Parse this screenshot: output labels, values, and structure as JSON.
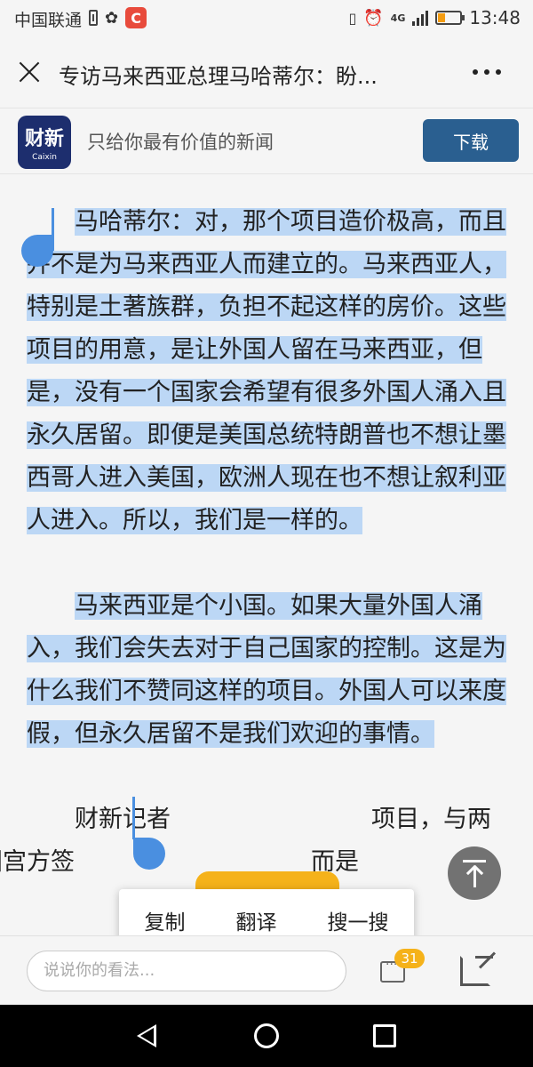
{
  "status_bar": {
    "carrier": "中国联通",
    "app_badge": "C",
    "network": "4G",
    "time": "13:48"
  },
  "title_bar": {
    "title": "专访马来西亚总理马哈蒂尔：盼..."
  },
  "app_banner": {
    "logo_main": "财新",
    "logo_sub": "Caixin",
    "slogan": "只给你最有价值的新闻",
    "download_label": "下载"
  },
  "article": {
    "paragraphs": [
      "马哈蒂尔：对，那个项目造价极高，而且并不是为马来西亚人而建立的。马来西亚人，特别是土著族群，负担不起这样的房价。这些项目的用意，是让外国人留在马来西亚，但是，没有一个国家会希望有很多外国人涌入且永久居留。即便是美国总统特朗普也不想让墨西哥人进入美国，欧洲人现在也不想让叙利亚人进入。所以，我们是一样的。",
      "马来西亚是个小国。如果大量外国人涌入，我们会失去对于自己国家的控制。这是为什么我们不赞同这样的项目。外国人可以来度假，但永久居留不是我们欢迎的事情。",
      "财新记者"
    ],
    "partial_line_right": "，与两",
    "partial_line_right_prefix": "项目",
    "bottom_left_partial": "国宫方签",
    "bottom_right_partial": "而是"
  },
  "context_menu": {
    "items": [
      "复制",
      "翻译",
      "搜一搜"
    ]
  },
  "comment_bar": {
    "placeholder": "说说你的看法...",
    "comment_count": "31"
  }
}
